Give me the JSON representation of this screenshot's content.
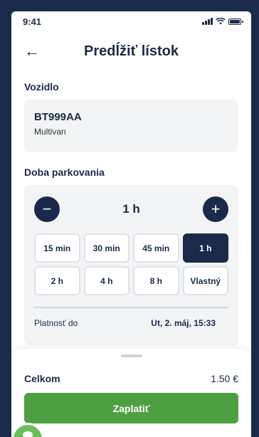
{
  "status_bar": {
    "time": "9:41"
  },
  "header": {
    "back_icon": "arrow-left-icon",
    "title": "Predĺžiť lístok"
  },
  "vehicle": {
    "section_label": "Vozidlo",
    "plate": "BT999AA",
    "model": "Multivan"
  },
  "duration": {
    "section_label": "Doba parkovania",
    "minus_label": "−",
    "plus_label": "+",
    "value": "1 h",
    "options": [
      {
        "label": "15 min",
        "active": false
      },
      {
        "label": "30 min",
        "active": false
      },
      {
        "label": "45 min",
        "active": false
      },
      {
        "label": "1 h",
        "active": true
      },
      {
        "label": "2 h",
        "active": false
      },
      {
        "label": "4 h",
        "active": false
      },
      {
        "label": "8 h",
        "active": false
      },
      {
        "label": "Vlastný",
        "active": false
      }
    ],
    "validity_label": "Platnosť do",
    "validity_date": "Ut, 2. máj, 15:33"
  },
  "summary": {
    "total_label": "Celkom",
    "total_amount": "1.50 €",
    "pay_label": "Zaplatiť"
  },
  "colors": {
    "navy": "#1b2a4a",
    "green": "#4e9e42",
    "card_bg": "#f2f4f5"
  }
}
